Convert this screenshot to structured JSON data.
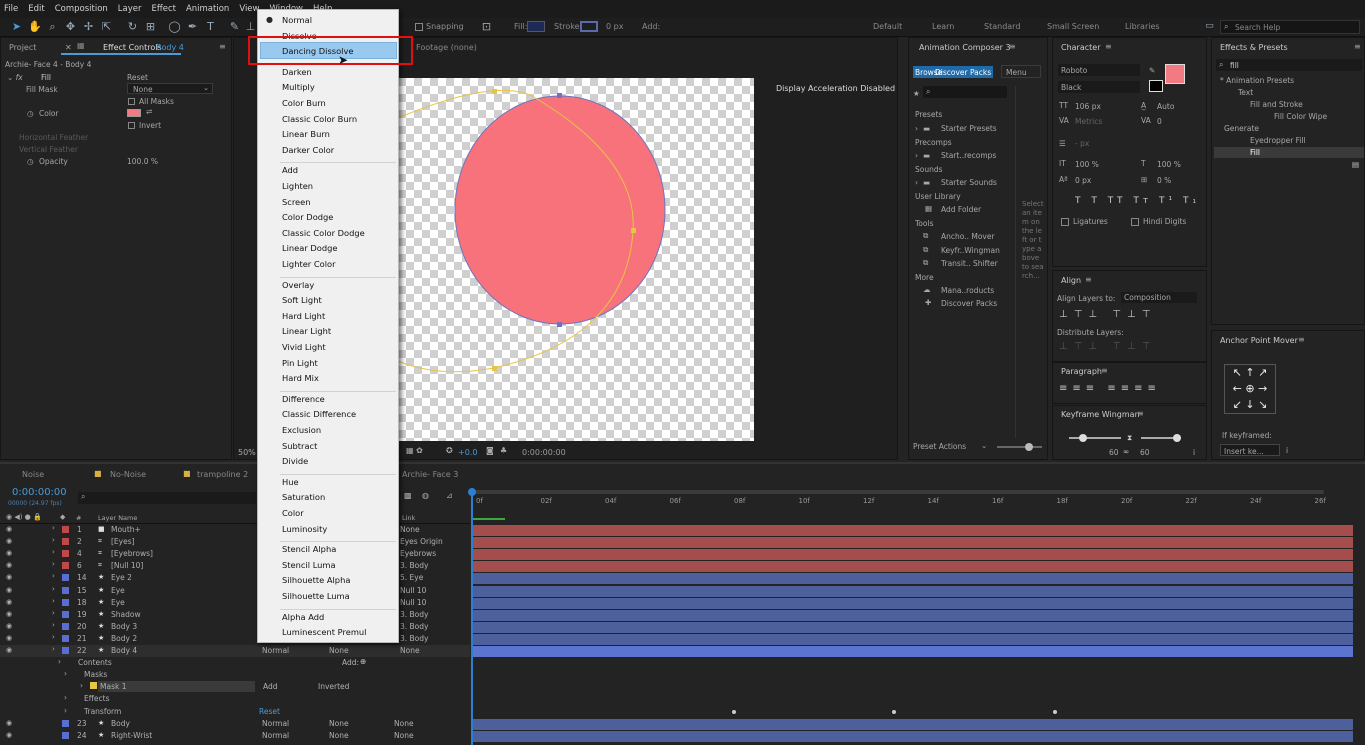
{
  "menubar": [
    "File",
    "Edit",
    "Composition",
    "Layer",
    "Effect",
    "Animation",
    "View",
    "Window",
    "Help"
  ],
  "toolbar": {
    "snapping": "Snapping",
    "fill": "Fill:",
    "stroke": "Stroke:",
    "px": "0 px",
    "add": "Add:",
    "workspaces": [
      "Default",
      "Learn",
      "Standard",
      "Small Screen",
      "Libraries"
    ],
    "search": "Search Help"
  },
  "left_panel": {
    "tab_project": "Project",
    "tab_effect": "Effect Controls",
    "tab_effect_target": "Body 4",
    "header": "Archie- Face 4 - Body 4",
    "rows": [
      {
        "label": "Fill",
        "value": "Reset"
      },
      {
        "label": "Fill Mask",
        "value": "None"
      },
      {
        "label": "All Masks",
        "value": ""
      },
      {
        "label": "Color",
        "value": ""
      },
      {
        "label": "Invert",
        "value": ""
      },
      {
        "label": "Horizontal Feather",
        "value": ""
      },
      {
        "label": "Vertical Feather",
        "value": ""
      },
      {
        "label": "Opacity",
        "value": "100.0 %"
      }
    ]
  },
  "comp": {
    "footage": "Footage (none)",
    "accel": "Display Acceleration Disabled",
    "zoom": "50%",
    "timecode": "0:00:00:00",
    "exposure": "+0.0"
  },
  "blend_menu": {
    "selected": "Dancing Dissolve",
    "groups": [
      [
        "Normal",
        "Dissolve",
        "Dancing Dissolve"
      ],
      [
        "Darken",
        "Multiply",
        "Color Burn",
        "Classic Color Burn",
        "Linear Burn",
        "Darker Color"
      ],
      [
        "Add",
        "Lighten",
        "Screen",
        "Color Dodge",
        "Classic Color Dodge",
        "Linear Dodge",
        "Lighter Color"
      ],
      [
        "Overlay",
        "Soft Light",
        "Hard Light",
        "Linear Light",
        "Vivid Light",
        "Pin Light",
        "Hard Mix"
      ],
      [
        "Difference",
        "Classic Difference",
        "Exclusion",
        "Subtract",
        "Divide"
      ],
      [
        "Hue",
        "Saturation",
        "Color",
        "Luminosity"
      ],
      [
        "Stencil Alpha",
        "Stencil Luma",
        "Silhouette Alpha",
        "Silhouette Luma"
      ],
      [
        "Alpha Add",
        "Luminescent Premul"
      ]
    ]
  },
  "anim_composer": {
    "title": "Animation Composer 3",
    "tabs": [
      "Browse",
      "Discover Packs"
    ],
    "menu": "Menu",
    "sections": [
      {
        "name": "Presets",
        "items": [
          "Starter Presets"
        ]
      },
      {
        "name": "Precomps",
        "items": [
          "Start..recomps"
        ]
      },
      {
        "name": "Sounds",
        "items": [
          "Starter Sounds"
        ]
      },
      {
        "name": "User Library",
        "items": [
          "Add Folder"
        ]
      },
      {
        "name": "Tools",
        "items": [
          "Ancho.. Mover",
          "Keyfr..Wingman",
          "Transit.. Shifter"
        ]
      },
      {
        "name": "More",
        "items": [
          "Mana..roducts",
          "Discover Packs"
        ]
      }
    ],
    "side_text": "Select an item on the left or type above to search...",
    "preset_actions": "Preset Actions"
  },
  "character": {
    "title": "Character",
    "font": "Roboto",
    "style": "Black",
    "size": "106 px",
    "leading": "Auto",
    "kerning": "Metrics",
    "tracking": "0",
    "stroke_px": "- px",
    "vscale": "100 %",
    "hscale": "100 %",
    "baseline": "0 px",
    "tsume": "0 %",
    "ligatures": "Ligatures",
    "hindi": "Hindi Digits",
    "fill_color": "#f27a82"
  },
  "align": {
    "title": "Align",
    "align_to_label": "Align Layers to:",
    "align_to": "Composition",
    "distribute": "Distribute Layers:"
  },
  "paragraph": {
    "title": "Paragraph"
  },
  "keyframe_wingman": {
    "title": "Keyframe Wingman",
    "v1": "60",
    "v2": "60"
  },
  "effects_presets": {
    "title": "Effects & Presets",
    "search": "fill",
    "tree": [
      "* Animation Presets",
      "Text",
      "Fill and Stroke",
      "Fill Color Wipe",
      "Generate",
      "Eyedropper Fill",
      "Fill"
    ]
  },
  "anchor": {
    "title": "Anchor Point Mover",
    "if_keyframed": "If keyframed:",
    "mode": "Insert ke..."
  },
  "timeline": {
    "tabs": [
      "Noise",
      "No-Noise",
      "trampoline 2",
      "Archie- Face 3"
    ],
    "timecode": "0:00:00:00",
    "fps": "00000 (24.97 fps)",
    "col_layer_name": "Layer Name",
    "col_link": "Link",
    "ruler": [
      "0f",
      "02f",
      "04f",
      "06f",
      "08f",
      "10f",
      "12f",
      "14f",
      "16f",
      "18f",
      "20f",
      "22f",
      "24f",
      "26f"
    ],
    "layers": [
      {
        "num": "1",
        "name": "Mouth+",
        "color": "red",
        "parent": "None"
      },
      {
        "num": "2",
        "name": "[Eyes]",
        "color": "red",
        "parent": "Eyes Origin"
      },
      {
        "num": "4",
        "name": "[Eyebrows]",
        "color": "red",
        "parent": "Eyebrows"
      },
      {
        "num": "6",
        "name": "[Null 10]",
        "color": "red",
        "parent": "3. Body"
      },
      {
        "num": "14",
        "name": "Eye 2",
        "color": "blue",
        "parent": "5. Eye"
      },
      {
        "num": "15",
        "name": "Eye",
        "color": "blue",
        "parent": "Null 10"
      },
      {
        "num": "18",
        "name": "Eye",
        "color": "blue",
        "parent": "Null 10"
      },
      {
        "num": "19",
        "name": "Shadow",
        "color": "blue",
        "parent": "3. Body"
      },
      {
        "num": "20",
        "name": "Body 3",
        "color": "blue",
        "parent": "3. Body"
      },
      {
        "num": "21",
        "name": "Body 2",
        "color": "blue",
        "parent": "3. Body"
      },
      {
        "num": "22",
        "name": "Body 4",
        "color": "blue",
        "parent": "None"
      }
    ],
    "sub_rows": [
      "Contents",
      "Masks",
      "Mask 1",
      "Effects",
      "Transform"
    ],
    "sub_add": "Add:",
    "mask_mode": "Add",
    "inverted": "Inverted",
    "reset": "Reset",
    "mode_normal": "Normal",
    "none": "None",
    "bottom_layers": [
      {
        "num": "23",
        "name": "Body"
      },
      {
        "num": "24",
        "name": "Right-Wrist"
      }
    ]
  },
  "colors": {
    "circle_fill": "#f8727c",
    "accent": "#4a9bd6",
    "menu_highlight": "#99c9ef",
    "red_outline": "#e01010"
  }
}
